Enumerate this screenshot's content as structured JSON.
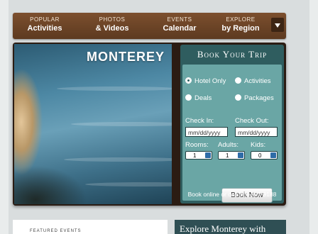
{
  "nav": {
    "items": [
      {
        "top": "POPULAR",
        "bottom": "Activities"
      },
      {
        "top": "PHOTOS",
        "bottom": "& Videos"
      },
      {
        "top": "EVENTS",
        "bottom": "Calendar"
      },
      {
        "top": "EXPLORE",
        "bottom": "by Region"
      }
    ],
    "dropdown_icon": "chevron-down-icon"
  },
  "hero": {
    "city": "MONTEREY"
  },
  "booking": {
    "title": "Book Your Trip",
    "options": {
      "hotel": "Hotel Only",
      "activities": "Activities",
      "deals": "Deals",
      "packages": "Packages"
    },
    "selected_option": "Hotel Only",
    "checkin_label": "Check In:",
    "checkout_label": "Check Out:",
    "checkin_placeholder": "mm/dd/yyyy",
    "checkout_placeholder": "mm/dd/yyyy",
    "rooms_label": "Rooms:",
    "adults_label": "Adults:",
    "kids_label": "Kids:",
    "rooms_value": "1",
    "adults_value": "1",
    "kids_value": "0",
    "button": "Book Now",
    "callout": "Book online or call 866-900-9188"
  },
  "bottom": {
    "left_label": "FEATURED EVENTS",
    "right_title": "Explore Monterey with"
  },
  "colors": {
    "nav": "#6b4426",
    "panel": "#2f5d5f",
    "panel_inner": "#6aa6a5"
  }
}
